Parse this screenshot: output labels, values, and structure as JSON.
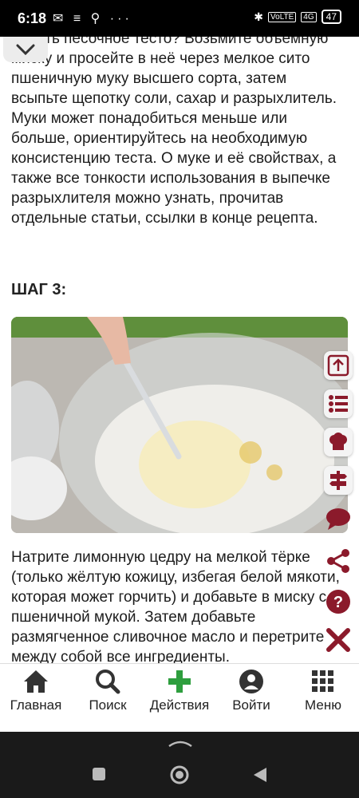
{
  "status_bar": {
    "time": "6:18",
    "left_icons": "✉ ≡ ⚲ ···",
    "network": "4G",
    "volte": "VoLTE",
    "battery": "47"
  },
  "article": {
    "para1": "делать песочное тесто? Возьмите объёмную миску и просейте в неё через мелкое сито пшеничную муку высшего сорта, затем всыпьте щепотку соли, сахар и разрыхлитель. Муки может понадобиться меньше или больше, ориентируйтесь на необходимую консистенцию теста. О муке и её свойствах, а также все тонкости использования в выпечке разрыхлителя можно узнать, прочитав отдельные статьи, ссылки в конце рецепта.",
    "step_title": "ШАГ 3:",
    "para2": "Натрите лимонную цедру на мелкой тёрке (только жёлтую кожицу, избегая белой мякоти, которая может горчить) и добавьте в миску с пшеничной мукой. Затем добавьте размягченное сливочное масло и перетрите между собой все ингредиенты."
  },
  "side_tools": [
    {
      "icon": "scroll-top-icon"
    },
    {
      "icon": "list-icon"
    },
    {
      "icon": "chef-hat-icon"
    },
    {
      "icon": "signpost-icon"
    },
    {
      "icon": "comment-icon"
    },
    {
      "icon": "share-icon"
    },
    {
      "icon": "help-icon"
    },
    {
      "icon": "close-icon"
    }
  ],
  "bottom_nav": [
    {
      "label": "Главная",
      "icon": "home-icon"
    },
    {
      "label": "Поиск",
      "icon": "search-icon"
    },
    {
      "label": "Действия",
      "icon": "plus-icon"
    },
    {
      "label": "Войти",
      "icon": "user-icon"
    },
    {
      "label": "Меню",
      "icon": "grid-icon"
    }
  ],
  "colors": {
    "accent": "#8b1a2b",
    "action_green": "#2e9e3e",
    "nav_icon": "#333333"
  }
}
